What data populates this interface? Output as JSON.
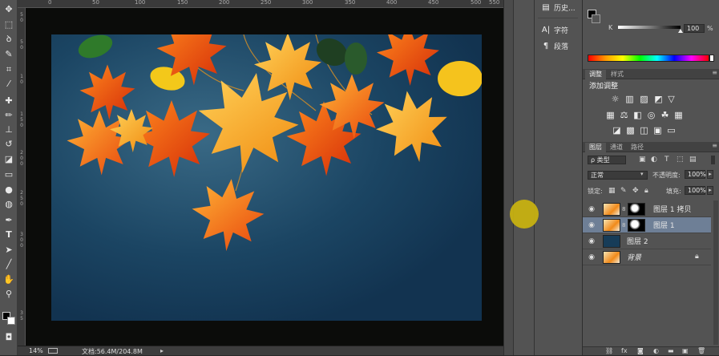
{
  "toolbar": {
    "tools": [
      "move-tool",
      "marquee-tool",
      "lasso-tool",
      "quick-select-tool",
      "crop-tool",
      "eyedropper-tool",
      "healing-tool",
      "brush-tool",
      "stamp-tool",
      "history-brush-tool",
      "eraser-tool",
      "gradient-tool",
      "blur-tool",
      "dodge-tool",
      "pen-tool",
      "type-tool",
      "path-select-tool",
      "shape-tool",
      "hand-tool",
      "zoom-tool"
    ],
    "type_glyph": "T"
  },
  "ruler": {
    "top_labels": [
      "0",
      "50",
      "100",
      "150",
      "200",
      "250",
      "300",
      "350",
      "400",
      "450",
      "500",
      "550"
    ],
    "left_labels": [
      "5",
      "0",
      "5",
      "0",
      "1",
      "0",
      "1",
      "5",
      "0",
      "2",
      "0",
      "0",
      "2",
      "5",
      "0",
      "3",
      "0",
      "0",
      "3",
      "5"
    ]
  },
  "status": {
    "zoom": "14%",
    "doc_size": "文档:56.4M/204.8M"
  },
  "mini_panel": {
    "history_label": "历史...",
    "char_label": "字符",
    "para_label": "段落"
  },
  "color_panel": {
    "k_label": "K",
    "k_value": "100",
    "k_unit": "%",
    "k_value_fraction": 1.0
  },
  "adjust_panel": {
    "tabs": [
      "调整",
      "样式"
    ],
    "title": "添加调整"
  },
  "layers_panel": {
    "tabs": [
      "图层",
      "通道",
      "路径"
    ],
    "filter_label": "ρ 类型",
    "blend_mode": "正常",
    "opacity_label": "不透明度:",
    "opacity_value": "100%",
    "lock_label": "锁定:",
    "fill_label": "填充:",
    "fill_value": "100%",
    "layers": [
      {
        "name": "图层 1 拷贝",
        "selected": false,
        "has_mask": true,
        "thumb": "leaves"
      },
      {
        "name": "图层 1",
        "selected": true,
        "has_mask": true,
        "thumb": "leaves"
      },
      {
        "name": "图层 2",
        "selected": false,
        "has_mask": false,
        "thumb": "blue"
      },
      {
        "name": "背景",
        "selected": false,
        "has_mask": false,
        "thumb": "leaves",
        "locked": true
      }
    ]
  },
  "colors": {
    "doc_background": "#173c58",
    "canvas_surround": "#0b0c0a",
    "selected_layer": "#6e7f96",
    "panel": "#535353",
    "cursor_highlight": "#cbb40f"
  }
}
